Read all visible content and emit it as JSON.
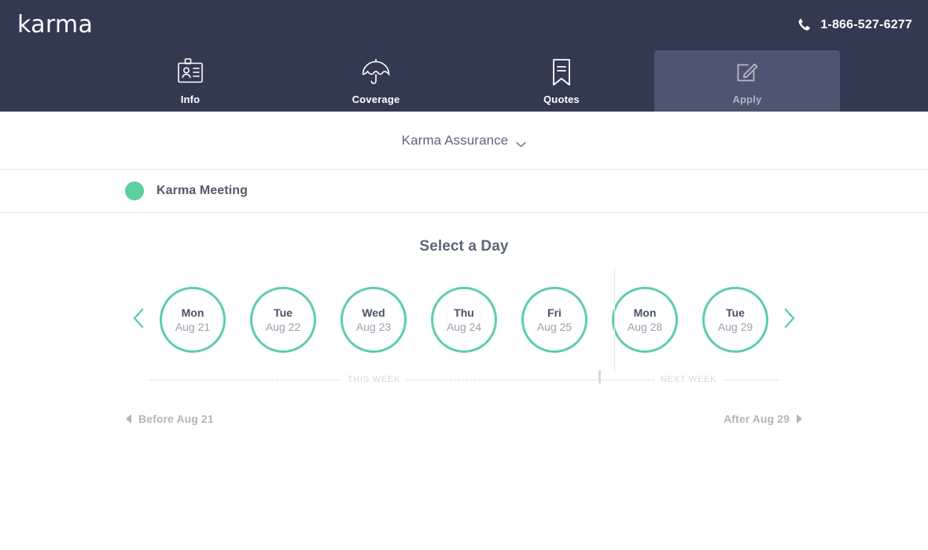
{
  "brand": {
    "logo": "karma"
  },
  "header": {
    "phone_icon": "phone-icon",
    "phone_number": "1-866-527-6277"
  },
  "nav": {
    "tabs": [
      {
        "label": "Info",
        "icon": "id-badge-icon",
        "active": false
      },
      {
        "label": "Coverage",
        "icon": "umbrella-icon",
        "active": false
      },
      {
        "label": "Quotes",
        "icon": "bookmark-icon",
        "active": false
      },
      {
        "label": "Apply",
        "icon": "edit-pencil-square-icon",
        "active": true
      }
    ]
  },
  "product": {
    "name": "Karma Assurance",
    "chevron_icon": "chevron-down-icon"
  },
  "meeting": {
    "status_icon": "status-dot-icon",
    "title": "Karma Meeting"
  },
  "day_picker": {
    "title": "Select a Day",
    "prev_icon": "chevron-left-icon",
    "next_icon": "chevron-right-icon",
    "days": [
      {
        "dow": "Mon",
        "date": "Aug 21",
        "week": "this"
      },
      {
        "dow": "Tue",
        "date": "Aug 22",
        "week": "this"
      },
      {
        "dow": "Wed",
        "date": "Aug 23",
        "week": "this"
      },
      {
        "dow": "Thu",
        "date": "Aug 24",
        "week": "this"
      },
      {
        "dow": "Fri",
        "date": "Aug 25",
        "week": "this"
      },
      {
        "dow": "Mon",
        "date": "Aug 28",
        "week": "next"
      },
      {
        "dow": "Tue",
        "date": "Aug 29",
        "week": "next"
      }
    ],
    "week_labels": {
      "this": "THIS WEEK",
      "next": "NEXT WEEK"
    },
    "range_nav": {
      "before_label": "Before Aug 21",
      "before_icon": "triangle-left-icon",
      "after_label": "After Aug 29",
      "after_icon": "triangle-right-icon"
    }
  },
  "colors": {
    "header_bg": "#323a52",
    "active_tab_bg": "#4e5571",
    "accent_green": "#5ecfa3",
    "text_dark": "#5d6577",
    "text_muted": "#9aa0ad",
    "divider": "#e6e7eb"
  }
}
